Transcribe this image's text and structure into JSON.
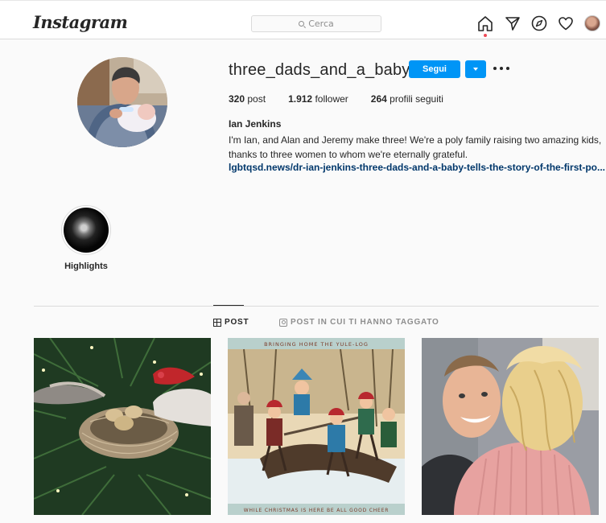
{
  "header": {
    "logo": "Instagram",
    "search_placeholder": "Cerca",
    "icons": [
      "home-icon",
      "direct-icon",
      "explore-icon",
      "heart-icon",
      "profile-avatar"
    ]
  },
  "profile": {
    "username": "three_dads_and_a_baby",
    "follow_label": "Segui",
    "stats": {
      "posts_count": "320",
      "posts_label": "post",
      "followers_count": "1.912",
      "followers_label": "follower",
      "following_count": "264",
      "following_label": "profili seguiti"
    },
    "name": "Ian Jenkins",
    "bio": "I'm Ian, and Alan and Jeremy make three! We're a poly family raising two amazing kids, thanks to three women to whom we're eternally grateful.",
    "link": "lgbtqsd.news/dr-ian-jenkins-three-dads-and-a-baby-tells-the-story-of-the-first-po..."
  },
  "highlights": [
    {
      "label": "Highlights"
    }
  ],
  "tabs": [
    {
      "label": "POST",
      "active": true
    },
    {
      "label": "POST IN CUI TI HANNO TAGGATO",
      "active": false
    }
  ],
  "posts": {
    "post2_banner_top": "BRINGING HOME THE YULE-LOG",
    "post2_banner_bottom": "WHILE CHRISTMAS IS HERE BE ALL GOOD CHEER"
  },
  "colors": {
    "accent": "#0095f6",
    "link": "#00376b",
    "notification": "#ed4956"
  }
}
